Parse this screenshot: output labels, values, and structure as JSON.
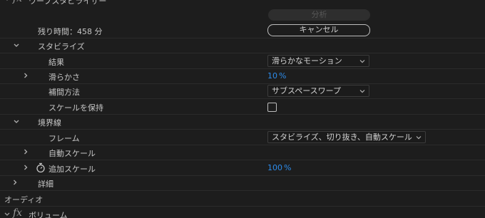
{
  "effect_header": {
    "title": "ワープスタビライザー"
  },
  "analyze_row": {
    "analyze_label": "分析"
  },
  "remaining_row": {
    "label": "残り時間：458 分",
    "cancel_label": "キャンセル"
  },
  "stabilize_group": {
    "title": "スタビライズ",
    "result": {
      "label": "結果",
      "value": "滑らかなモーション"
    },
    "smoothness": {
      "label": "滑らかさ",
      "value": "10",
      "unit": "%"
    },
    "method": {
      "label": "補間方法",
      "value": "サブスペースワープ"
    },
    "preserve_scale": {
      "label": "スケールを保持",
      "checked": false
    }
  },
  "borders_group": {
    "title": "境界線",
    "framing": {
      "label": "フレーム",
      "value": "スタビライズ、切り抜き、自動スケール"
    },
    "auto_scale": {
      "label": "自動スケール"
    },
    "additional_scale": {
      "label": "追加スケール",
      "value": "100",
      "unit": "%"
    }
  },
  "details": {
    "label": "詳細"
  },
  "audio_section": {
    "title": "オーディオ"
  },
  "volume_effect": {
    "title": "ボリューム"
  },
  "colors": {
    "background": "#1d1d1d",
    "text": "#c6c6c6",
    "value_blue": "#2d8ceb",
    "separator": "#2b2b2b"
  }
}
